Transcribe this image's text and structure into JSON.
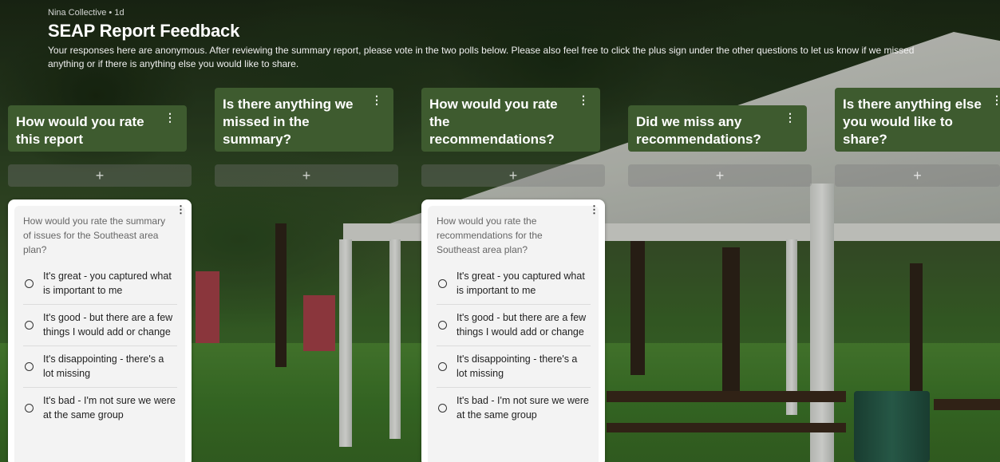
{
  "header": {
    "meta": "Nina Collective • 1d",
    "title": "SEAP Report Feedback",
    "description": "Your responses here are anonymous. After reviewing the summary report, please vote in the two polls below. Please also feel free to click the plus sign under the other questions to let us know if we missed anything or if there is anything else you would like to share."
  },
  "columns": [
    {
      "question": "How would you rate this report",
      "menu_icon": "⋮",
      "add_icon": "+"
    },
    {
      "question": "Is there anything we missed in the summary?",
      "menu_icon": "⋮",
      "add_icon": "+"
    },
    {
      "question": "How would you rate the recommendations?",
      "menu_icon": "⋮",
      "add_icon": "+"
    },
    {
      "question": "Did we miss any recommendations?",
      "menu_icon": "⋮",
      "add_icon": "+"
    },
    {
      "question": "Is there anything else you would like to share?",
      "menu_icon": "⋮",
      "add_icon": "+"
    }
  ],
  "polls": [
    {
      "prompt": "How would you rate the summary of issues for the Southeast area plan?",
      "menu_icon": "⋮",
      "options": [
        "It's great - you captured what is important to me",
        "It's good - but there are a few things I would add or change",
        "It's disappointing - there's a lot missing",
        "It's bad - I'm not sure we were at the same group"
      ]
    },
    {
      "prompt": "How would you rate the recommendations for the Southeast area plan?",
      "menu_icon": "⋮",
      "options": [
        "It's great - you captured what is important to me",
        "It's good - but there are a few things I would add or change",
        "It's disappointing - there's a lot missing",
        "It's bad - I'm not sure we were at the same group"
      ]
    }
  ],
  "colors": {
    "column_header": "#3e5b2f",
    "card_bg": "#ffffff",
    "card_inner": "#f3f3f3"
  }
}
